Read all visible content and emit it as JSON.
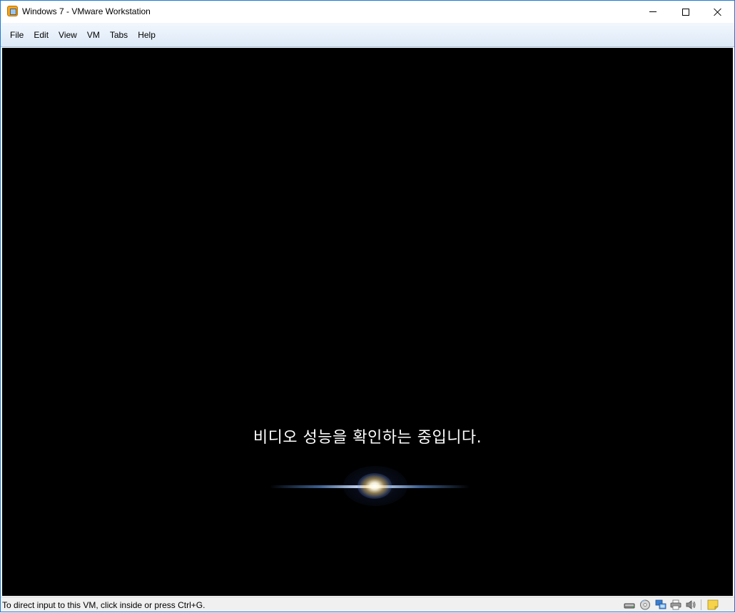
{
  "window": {
    "title": "Windows 7 - VMware Workstation",
    "icon": "vmware-workstation-icon"
  },
  "menubar": {
    "items": [
      {
        "label": "File"
      },
      {
        "label": "Edit"
      },
      {
        "label": "View"
      },
      {
        "label": "VM"
      },
      {
        "label": "Tabs"
      },
      {
        "label": "Help"
      }
    ]
  },
  "vm": {
    "boot_message": "비디오 성능을 확인하는 중입니다.",
    "background_color": "#000000"
  },
  "statusbar": {
    "hint": "To direct input to this VM, click inside or press Ctrl+G.",
    "device_icons": [
      "hard-disk-icon",
      "cd-dvd-icon",
      "network-adapter-icon",
      "printer-icon",
      "sound-card-icon",
      "message-log-icon"
    ]
  }
}
